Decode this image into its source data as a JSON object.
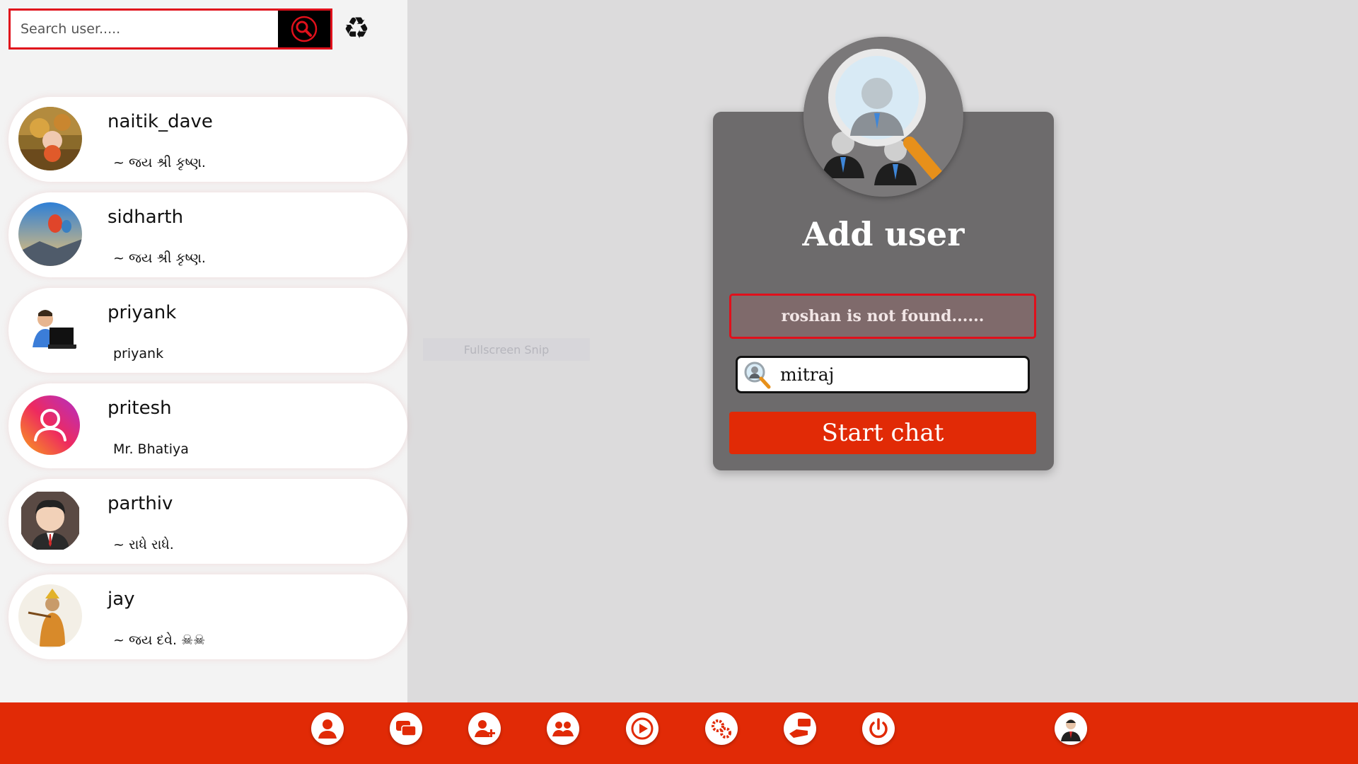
{
  "search": {
    "placeholder": "Search user....."
  },
  "icons": {
    "search_button": "search-icon",
    "refresh": "recycle-icon"
  },
  "colors": {
    "accent": "#e12a06",
    "border_red": "#e0101b",
    "modal_bg": "#6d6b6c",
    "panel_bg": "#dcdbdc",
    "sidebar_bg": "#f3f3f3"
  },
  "users": [
    {
      "name": "naitik_dave",
      "status": "~ જય શ્રી કૃષ્ણ."
    },
    {
      "name": "sidharth",
      "status": "~ જય શ્રી કૃષ્ણ."
    },
    {
      "name": "priyank",
      "status": "priyank"
    },
    {
      "name": "pritesh",
      "status": "Mr. Bhatiya"
    },
    {
      "name": "parthiv",
      "status": "~ રાધે રાધે."
    },
    {
      "name": "jay",
      "status": "~ જય દવે. ☠☠"
    }
  ],
  "modal": {
    "title": "Add user",
    "error": "roshan is not found......",
    "input_value": "mitraj",
    "button": "Start chat"
  },
  "ghost": {
    "text": "Fullscreen Snip"
  },
  "bottom_nav": [
    "profile-icon",
    "chats-icon",
    "add-user-icon",
    "group-icon",
    "video-icon",
    "settings-icon",
    "feedback-icon",
    "power-icon",
    "account-avatar"
  ]
}
